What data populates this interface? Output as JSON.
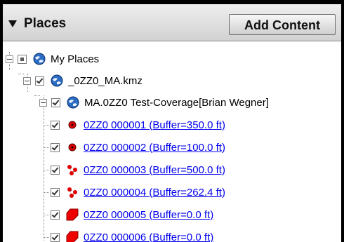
{
  "header": {
    "title": "Places",
    "add_content_label": "Add Content"
  },
  "tree": {
    "root": {
      "label": "My Places",
      "icon": "earth-globe-icon"
    },
    "file": {
      "label": "_0ZZ0_MA.kmz",
      "icon": "earth-globe-icon"
    },
    "folder": {
      "label": "MA.0ZZ0 Test-Coverage[Brian Wegner]",
      "icon": "earth-globe-icon"
    },
    "items": [
      {
        "label": "0ZZ0 000001 (Buffer=350.0 ft)",
        "icon": "red-point-icon"
      },
      {
        "label": "0ZZ0 000002 (Buffer=100.0 ft)",
        "icon": "red-point-icon"
      },
      {
        "label": "0ZZ0 000003 (Buffer=500.0 ft)",
        "icon": "red-multipoint-icon"
      },
      {
        "label": "0ZZ0 000004 (Buffer=262.4 ft)",
        "icon": "red-multipoint-icon"
      },
      {
        "label": "0ZZ0 000005 (Buffer=0.0 ft)",
        "icon": "red-polygon-icon"
      },
      {
        "label": "0ZZ0 000006 (Buffer=0.0 ft)",
        "icon": "red-polygon-icon"
      }
    ]
  },
  "colors": {
    "link": "#0000ee",
    "feature_red": "#e00000",
    "globe_blue": "#2b6cc4"
  }
}
